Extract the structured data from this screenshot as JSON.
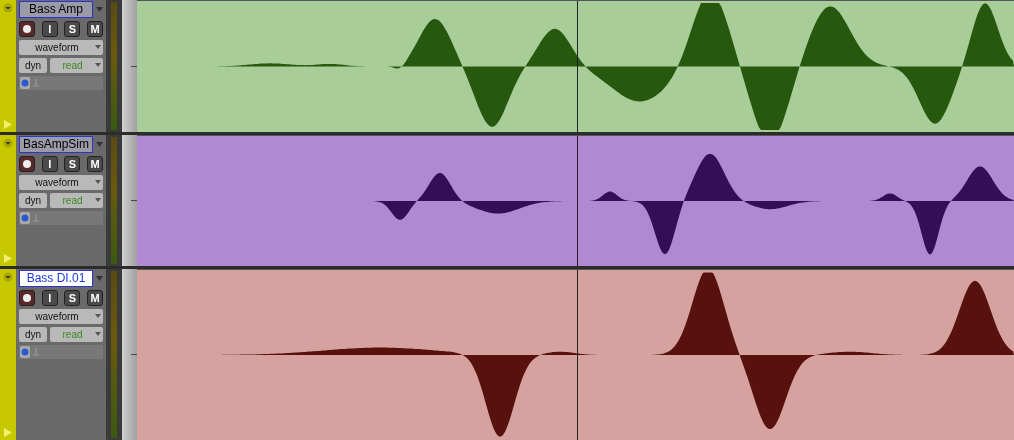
{
  "tracks": [
    {
      "name": "Bass Amp",
      "name_selected": false,
      "input": "I",
      "solo": "S",
      "mute": "M",
      "view": "waveform",
      "dyn": "dyn",
      "automation": "read",
      "color": "#a9cd98"
    },
    {
      "name": "BasAmpSim",
      "name_selected": false,
      "input": "I",
      "solo": "S",
      "mute": "M",
      "view": "waveform",
      "dyn": "dyn",
      "automation": "read",
      "color": "#b089d2"
    },
    {
      "name": "Bass DI.01",
      "name_selected": true,
      "input": "I",
      "solo": "S",
      "mute": "M",
      "view": "waveform",
      "dyn": "dyn",
      "automation": "read",
      "color": "#d6a29f"
    }
  ]
}
